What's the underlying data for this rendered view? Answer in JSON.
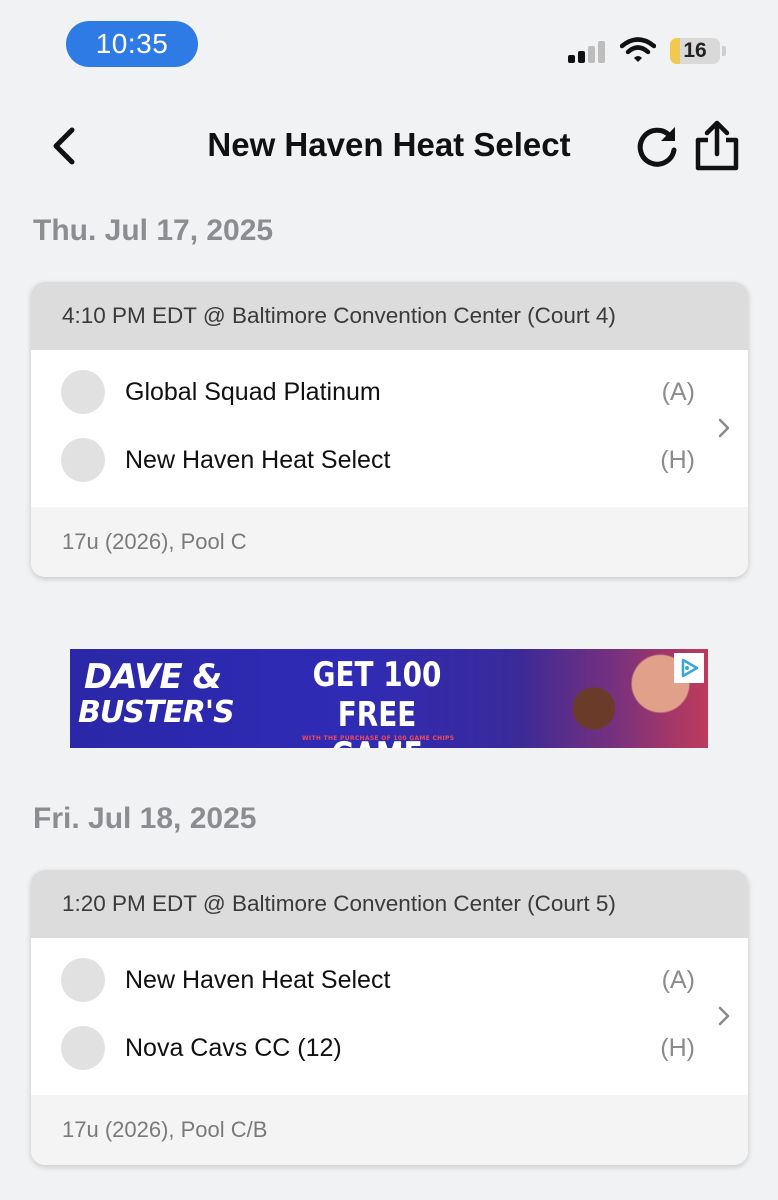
{
  "status_bar": {
    "time": "10:35",
    "battery_level": "16",
    "signal_icon": "cellular-signal-icon",
    "wifi_icon": "wifi-icon"
  },
  "nav": {
    "title": "New Haven Heat Select",
    "back_icon": "chevron-left-icon",
    "refresh_icon": "refresh-icon",
    "share_icon": "share-icon"
  },
  "days": [
    {
      "date": "Thu. Jul 17, 2025",
      "game": {
        "header": "4:10 PM EDT @ Baltimore Convention Center (Court 4)",
        "teams": [
          {
            "name": "Global Squad Platinum",
            "side": "(A)"
          },
          {
            "name": "New Haven Heat Select",
            "side": "(H)"
          }
        ],
        "footer": "17u (2026), Pool C"
      }
    },
    {
      "date": "Fri. Jul 18, 2025",
      "game": {
        "header": "1:20 PM EDT @ Baltimore Convention Center (Court 5)",
        "teams": [
          {
            "name": "New Haven Heat Select",
            "side": "(A)"
          },
          {
            "name": "Nova Cavs CC (12)",
            "side": "(H)"
          }
        ],
        "footer": "17u (2026), Pool C/B"
      }
    }
  ],
  "ad": {
    "logo_line1": "DAVE &",
    "logo_line2": "BUSTER'S",
    "headline_line1": "GET 100 FREE",
    "headline_line2": "GAME CHIPS",
    "fine_print": "WITH THE PURCHASE OF 100 GAME CHIPS",
    "badge_icon": "ad-choices-icon"
  },
  "colors": {
    "accent_pill": "#2f7be6",
    "background": "#f1f2f4",
    "card_header": "#dcdcdc",
    "muted_text": "#8b8d91"
  }
}
